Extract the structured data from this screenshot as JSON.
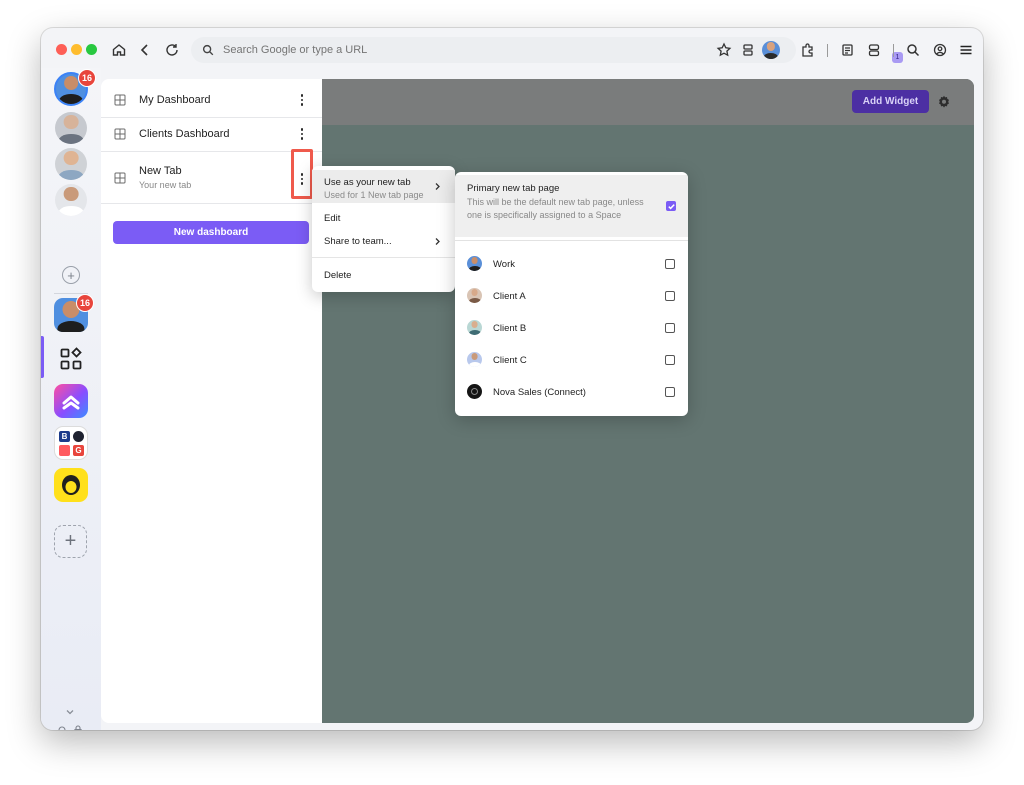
{
  "browser": {
    "url_placeholder": "Search Google or type a URL",
    "reading_list_badge": "1"
  },
  "sidebar": {
    "profile_badge": "16",
    "app_badge": "16"
  },
  "dashboards": {
    "items": [
      {
        "title": "My Dashboard",
        "subtitle": ""
      },
      {
        "title": "Clients Dashboard",
        "subtitle": ""
      },
      {
        "title": "New Tab",
        "subtitle": "Your new tab"
      }
    ],
    "new_button": "New dashboard"
  },
  "main": {
    "add_widget": "Add Widget"
  },
  "context_menu": {
    "use_new_tab": "Use as your new tab",
    "use_new_tab_sub": "Used for 1 New tab page",
    "edit": "Edit",
    "share": "Share to team...",
    "delete": "Delete"
  },
  "submenu": {
    "primary_title": "Primary new tab page",
    "primary_desc": "This will be the default new tab page, unless one is specifically assigned to a Space",
    "primary_checked": true,
    "spaces": [
      {
        "name": "Work",
        "checked": false
      },
      {
        "name": "Client A",
        "checked": false
      },
      {
        "name": "Client B",
        "checked": false
      },
      {
        "name": "Client C",
        "checked": false
      },
      {
        "name": "Nova Sales (Connect)",
        "checked": false
      }
    ]
  },
  "colors": {
    "accent": "#7b5cf5",
    "badge": "#e8453c",
    "main_bg": "#637571",
    "highlight": "#ef5a4c"
  }
}
